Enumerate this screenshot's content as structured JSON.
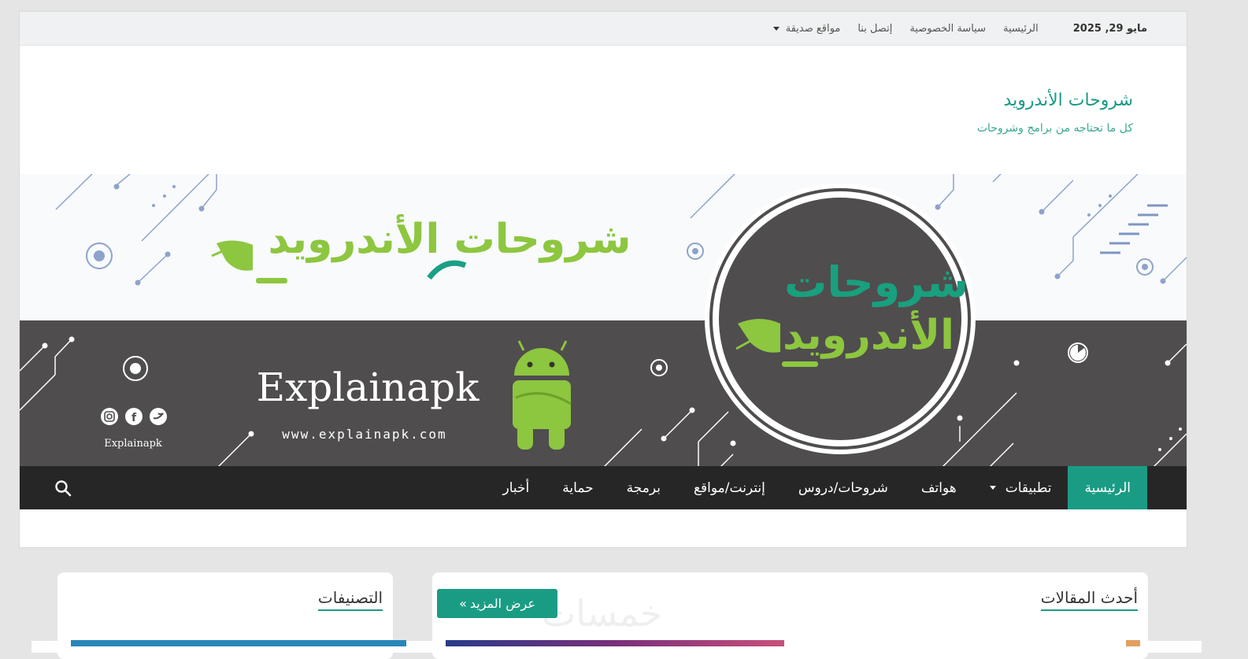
{
  "topbar": {
    "date": "مايو 29, 2025",
    "links": [
      "الرئيسية",
      "سياسة الخصوصية",
      "إتصل بنا"
    ],
    "dropdown_label": "مواقع صديقة"
  },
  "site": {
    "title": "شروحات الأندرويد",
    "tagline": "كل ما تحتاجه من برامج وشروحات"
  },
  "banner": {
    "logo_text_line1": "شروحات",
    "logo_text_line2": "الأندرويد",
    "header_text": "شروحات الأندرويد",
    "brand": "Explainapk",
    "url": "www.explainapk.com",
    "social_caption": "Explainapk"
  },
  "nav": {
    "items": [
      "الرئيسية",
      "تطبيقات",
      "هواتف",
      "شروحات/دروس",
      "إنترنت/مواقع",
      "برمجة",
      "حماية",
      "أخبار"
    ]
  },
  "sections": {
    "latest_title": "أحدث المقالات",
    "categories_title": "التصنيفات",
    "more_button": "عرض المزيد",
    "more_icon": "»",
    "watermark": "خمسات"
  },
  "colors": {
    "accent": "#1a9c84",
    "android_green": "#8dc63f",
    "banner_dark": "#4f4d4e",
    "nav_bg": "#262626"
  },
  "icons": [
    "search-icon",
    "twitter-icon",
    "facebook-icon",
    "instagram-icon",
    "caret-down-icon",
    "android-robot-icon"
  ]
}
